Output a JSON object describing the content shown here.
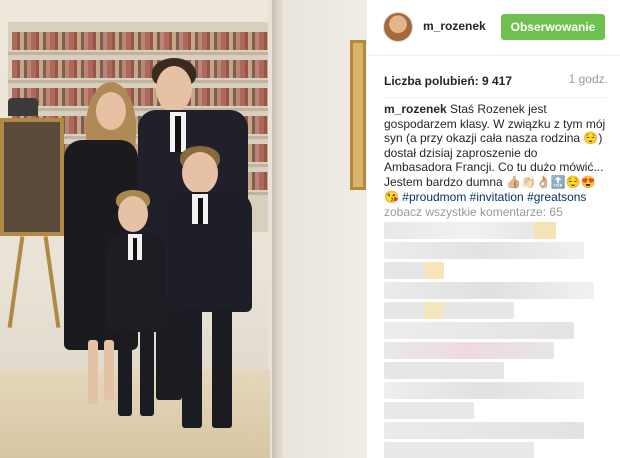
{
  "post": {
    "username": "m_rozenek",
    "follow_label": "Obserwowanie",
    "likes_label": "Liczba polubień: 9 417",
    "time": "1 godz.",
    "caption_user": "m_rozenek",
    "caption_text": "Staś Rozenek jest gospodarzem klasy. W związku z tym mój syn (a przy okazji cała nasza rodzina 😌) dostał dzisiaj zaproszenie do Ambasadora Francji. Co tu dużo mówić... Jestem bardzo dumna 👍🏼👏🏻👌🏼🔝😌😍😘",
    "hashtags": [
      "#proudmom",
      "#invitation",
      "#greatsons"
    ],
    "view_comments": "zobacz wszystkie komentarze: 65"
  },
  "colors": {
    "follow_button": "#70c050",
    "hashtag": "#003569",
    "muted_text": "#999999"
  },
  "icons": {
    "avatar": "profile-avatar"
  }
}
